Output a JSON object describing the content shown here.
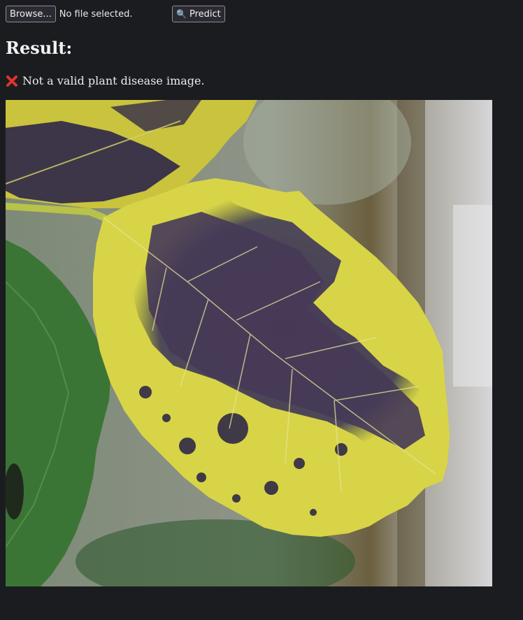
{
  "toolbar": {
    "browse_label": "Browse...",
    "file_status": "No file selected.",
    "predict_label": "Predict",
    "predict_icon": "magnifier-icon"
  },
  "result": {
    "title": "Result:",
    "icon": "red-x-icon",
    "message": "Not a valid plant disease image."
  },
  "image": {
    "subject": "leaf-photo",
    "colors": {
      "yellow": "#d9d34a",
      "purple": "#4a3e57",
      "green": "#3f7a3a",
      "background": "#8a8f88"
    }
  },
  "colors": {
    "page_background": "#1b1c20",
    "error_red": "#e0322e"
  }
}
